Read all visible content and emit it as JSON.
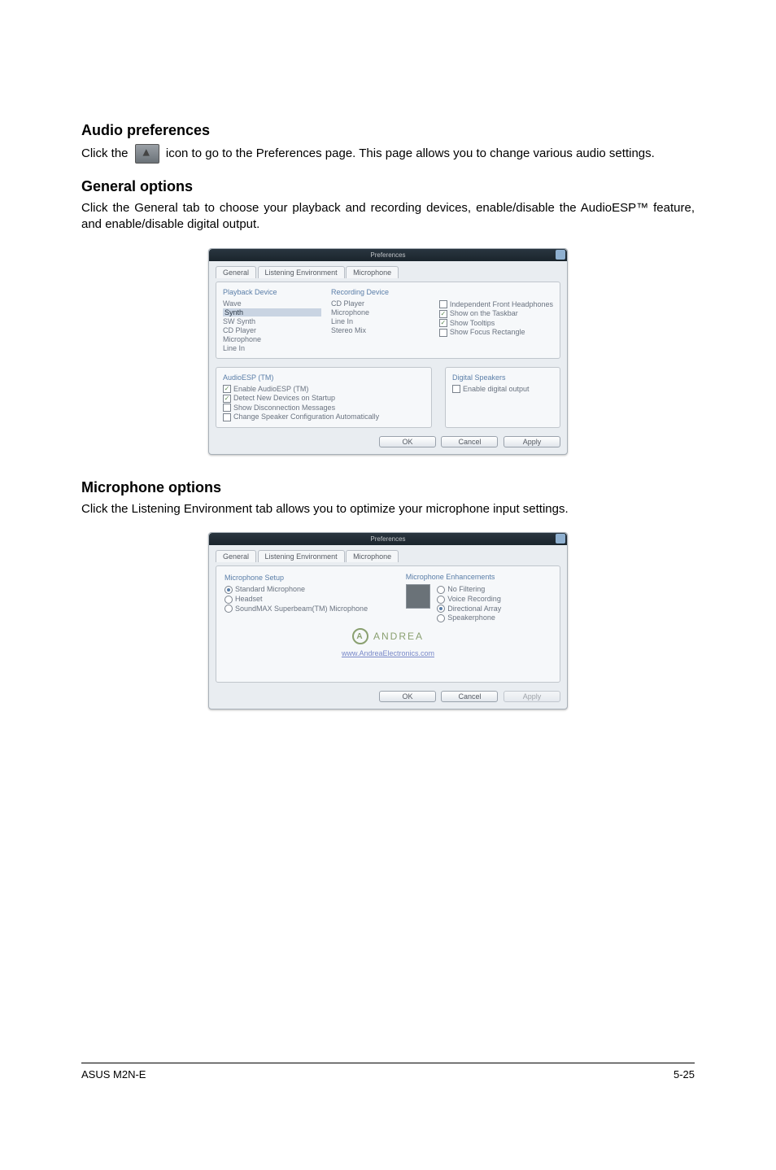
{
  "sections": {
    "audio_pref": {
      "title": "Audio preferences",
      "line1_prefix": "Click the ",
      "line1_suffix": " icon to go to the Preferences page. This page allows you to change various audio settings."
    },
    "general_opts": {
      "title": "General options",
      "body": "Click the General tab to choose your playback and recording devices, enable/disable the AudioESP™ feature, and enable/disable digital output."
    },
    "mic_opts": {
      "title": "Microphone options",
      "body": "Click the Listening Environment tab allows you to optimize your microphone input settings."
    }
  },
  "dialog1": {
    "title": "Preferences",
    "tabs": [
      "General",
      "Listening Environment",
      "Microphone"
    ],
    "playback": {
      "heading": "Playback Device",
      "items_pre": [
        "Wave"
      ],
      "selected": "Synth",
      "items_post": [
        "SW Synth",
        "CD Player",
        "Microphone",
        "Line In"
      ]
    },
    "recording": {
      "heading": "Recording Device",
      "items": [
        "CD Player",
        "Microphone",
        "Line In",
        "Stereo Mix"
      ]
    },
    "right_checks": {
      "items": [
        {
          "label": "Independent Front Headphones",
          "checked": false
        },
        {
          "label": "Show on the Taskbar",
          "checked": true
        },
        {
          "label": "Show Tooltips",
          "checked": true
        },
        {
          "label": "Show Focus Rectangle",
          "checked": false
        }
      ]
    },
    "audioesp": {
      "heading": "AudioESP (TM)",
      "items": [
        {
          "label": "Enable AudioESP (TM)",
          "checked": true
        },
        {
          "label": "Detect New Devices on Startup",
          "checked": true
        },
        {
          "label": "Show Disconnection Messages",
          "checked": false
        },
        {
          "label": "Change Speaker Configuration Automatically",
          "checked": false
        }
      ]
    },
    "digital": {
      "heading": "Digital Speakers",
      "item": {
        "label": "Enable digital output",
        "checked": false
      }
    },
    "buttons": {
      "ok": "OK",
      "cancel": "Cancel",
      "apply": "Apply"
    }
  },
  "dialog2": {
    "title": "Preferences",
    "tabs": [
      "General",
      "Listening Environment",
      "Microphone"
    ],
    "setup": {
      "heading": "Microphone Setup",
      "items": [
        {
          "label": "Standard Microphone",
          "checked": true
        },
        {
          "label": "Headset",
          "checked": false
        },
        {
          "label": "SoundMAX Superbeam(TM) Microphone",
          "checked": false
        }
      ]
    },
    "enhancements": {
      "heading": "Microphone Enhancements",
      "items": [
        {
          "label": "No Filtering",
          "checked": false
        },
        {
          "label": "Voice Recording",
          "checked": false
        },
        {
          "label": "Directional Array",
          "checked": true
        },
        {
          "label": "Speakerphone",
          "checked": false
        }
      ]
    },
    "andrea": {
      "logo_text": "ANDREA",
      "link": "www.AndreaElectronics.com"
    },
    "buttons": {
      "ok": "OK",
      "cancel": "Cancel",
      "apply": "Apply"
    }
  },
  "footer": {
    "left": "ASUS M2N-E",
    "right": "5-25"
  }
}
